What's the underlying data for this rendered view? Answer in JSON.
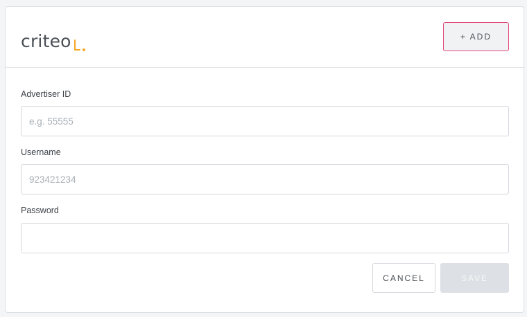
{
  "logo": {
    "text": "criteo",
    "mark": ".",
    "accent_color": "#f5a623"
  },
  "header": {
    "add_label": "+ ADD"
  },
  "form": {
    "advertiser_id": {
      "label": "Advertiser ID",
      "value": "",
      "placeholder": "e.g. 55555"
    },
    "username": {
      "label": "Username",
      "value": "",
      "placeholder": "923421234"
    },
    "password": {
      "label": "Password",
      "value": "",
      "placeholder": ""
    }
  },
  "actions": {
    "cancel_label": "CANCEL",
    "save_label": "SAVE",
    "save_enabled": false
  }
}
